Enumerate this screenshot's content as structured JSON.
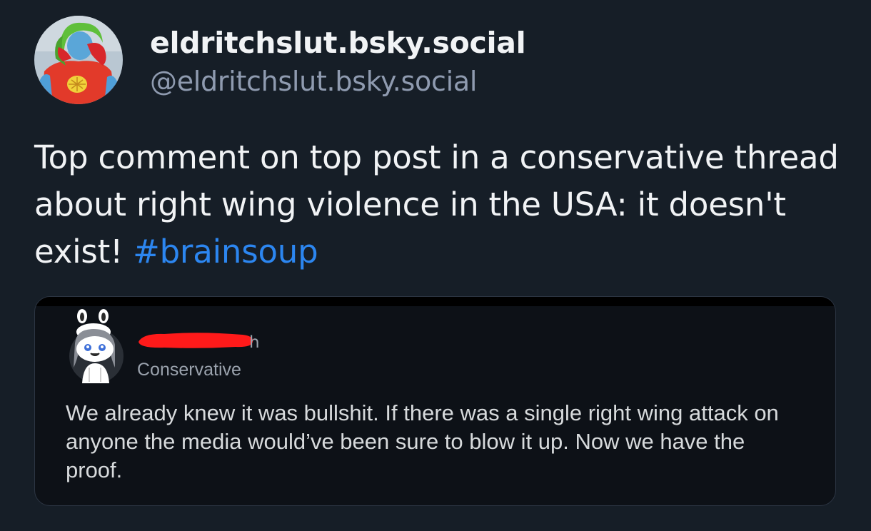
{
  "author": {
    "display_name": "eldritchslut.bsky.social",
    "handle": "@eldritchslut.bsky.social",
    "avatar_icon": "costumed-person-avatar"
  },
  "post": {
    "text": "Top comment on top post in a conservative thread about right wing violence in the USA: it doesn't exist! ",
    "hashtag": "#brainsoup"
  },
  "embed": {
    "avatar_icon": "snoo-bunny-avatar",
    "username_redacted": true,
    "time_suffix": "h",
    "community": "Conservative",
    "comment": "We already knew it was bullshit. If there was a single right wing attack on anyone the media would’ve been sure to blow it up. Now we have the proof."
  },
  "colors": {
    "background": "#161e27",
    "text": "#f1f3f5",
    "handle": "#8f9bb0",
    "hashtag": "#2c86f0",
    "embed_background": "#0d1117",
    "redaction": "#ff1a1a"
  }
}
